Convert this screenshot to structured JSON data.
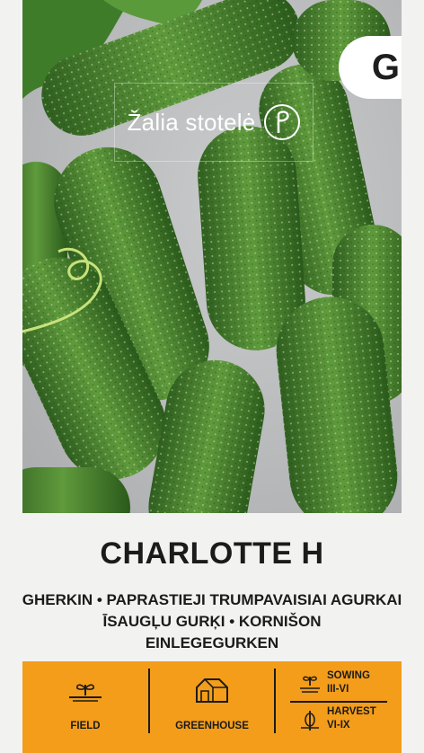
{
  "brand": {
    "name": "Žalia stotelė"
  },
  "badge": {
    "letter": "G"
  },
  "product": {
    "title": "CHARLOTTE H",
    "subtitle_lines": [
      "GHERKIN • PAPRASTIEJI TRUMPAVAISIAI AGURKAI",
      "ĪSAUGĻU GURĶI • KORNIŠON",
      "EINLEGEGURKEN"
    ]
  },
  "info": {
    "field_label": "FIELD",
    "greenhouse_label": "GREENHOUSE",
    "sowing_label": "SOWING",
    "sowing_period": "III-VI",
    "harvest_label": "HARVEST",
    "harvest_period": "VI-IX"
  },
  "colors": {
    "accent": "#f39d1a",
    "background": "#f2f2f1",
    "text": "#1b1b1b"
  }
}
